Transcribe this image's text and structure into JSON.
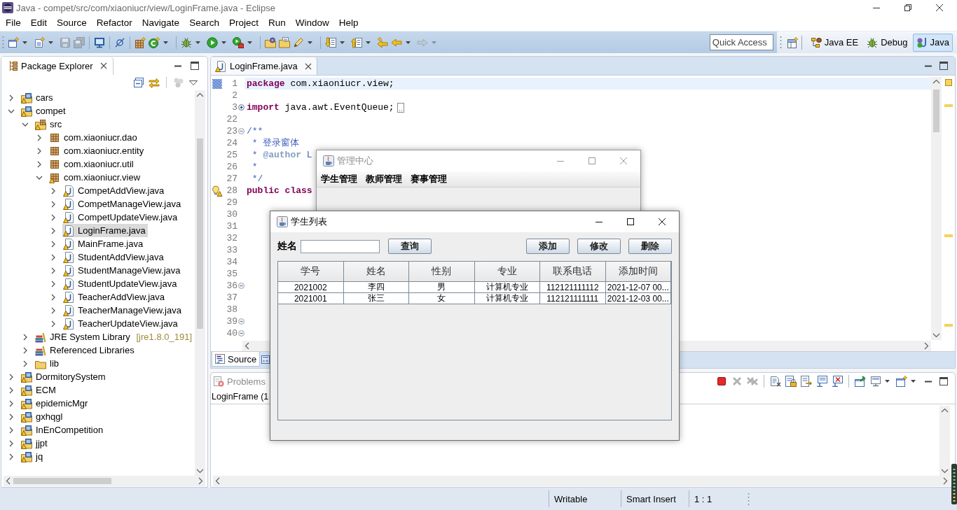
{
  "window": {
    "title": "Java - compet/src/com/xiaoniucr/view/LoginFrame.java - Eclipse"
  },
  "menu": [
    "File",
    "Edit",
    "Source",
    "Refactor",
    "Navigate",
    "Search",
    "Project",
    "Run",
    "Window",
    "Help"
  ],
  "toolbar": [
    {
      "kind": "new",
      "dropdown": true,
      "disabled": false
    },
    {
      "kind": "new-class",
      "dropdown": true,
      "disabled": false
    },
    {
      "kind": "save",
      "dropdown": false,
      "disabled": true
    },
    {
      "kind": "save-all",
      "dropdown": false,
      "disabled": true
    },
    {
      "kind": "separator"
    },
    {
      "kind": "monitor",
      "dropdown": false,
      "disabled": false
    },
    {
      "kind": "separator"
    },
    {
      "kind": "skip-breakpoints",
      "dropdown": false,
      "disabled": false
    },
    {
      "kind": "separator"
    },
    {
      "kind": "new-package",
      "dropdown": false,
      "disabled": false
    },
    {
      "kind": "refresh",
      "dropdown": true,
      "disabled": false
    },
    {
      "kind": "separator"
    },
    {
      "kind": "debug",
      "dropdown": true,
      "disabled": false
    },
    {
      "kind": "run",
      "dropdown": true,
      "disabled": false
    },
    {
      "kind": "run-external",
      "dropdown": true,
      "disabled": false
    },
    {
      "kind": "separator"
    },
    {
      "kind": "open-type",
      "dropdown": false,
      "disabled": false
    },
    {
      "kind": "open-task",
      "dropdown": false,
      "disabled": false
    },
    {
      "kind": "pen",
      "dropdown": true,
      "disabled": false
    },
    {
      "kind": "separator"
    },
    {
      "kind": "next-annotation",
      "dropdown": true,
      "disabled": false
    },
    {
      "kind": "prev-annotation",
      "dropdown": true,
      "disabled": false
    },
    {
      "kind": "last-edit",
      "dropdown": false,
      "disabled": false
    },
    {
      "kind": "back",
      "dropdown": true,
      "disabled": false
    },
    {
      "kind": "forward",
      "dropdown": true,
      "disabled": true
    }
  ],
  "quick_access": {
    "placeholder": "Quick Access"
  },
  "perspectives": [
    {
      "kind": "java-ee",
      "label": "Java EE",
      "selected": false
    },
    {
      "kind": "debug",
      "label": "Debug",
      "selected": false
    },
    {
      "kind": "java",
      "label": "Java",
      "selected": true
    }
  ],
  "package_explorer": {
    "title": "Package Explorer",
    "toolbar": [
      {
        "kind": "collapse-all",
        "dropdown": false,
        "disabled": false
      },
      {
        "kind": "link",
        "dropdown": false,
        "disabled": false
      },
      {
        "kind": "separator"
      },
      {
        "kind": "filter",
        "dropdown": false,
        "disabled": true
      },
      {
        "kind": "view-menu",
        "dropdown": false,
        "disabled": false
      }
    ],
    "tree": [
      {
        "kind": "project",
        "label": "cars",
        "warning": true,
        "expanded": false,
        "selected": false
      },
      {
        "kind": "project",
        "label": "compet",
        "warning": true,
        "expanded": true,
        "selected": false,
        "children": [
          {
            "kind": "source-folder",
            "label": "src",
            "warning": true,
            "expanded": true,
            "selected": false,
            "children": [
              {
                "kind": "package",
                "label": "com.xiaoniucr.dao",
                "warning": false,
                "expanded": false,
                "selected": false
              },
              {
                "kind": "package",
                "label": "com.xiaoniucr.entity",
                "warning": false,
                "expanded": false,
                "selected": false
              },
              {
                "kind": "package",
                "label": "com.xiaoniucr.util",
                "warning": false,
                "expanded": false,
                "selected": false
              },
              {
                "kind": "package",
                "label": "com.xiaoniucr.view",
                "warning": true,
                "expanded": true,
                "selected": false,
                "children": [
                  {
                    "kind": "java-file",
                    "label": "CompetAddView.java",
                    "warning": true,
                    "expanded": false,
                    "selected": false
                  },
                  {
                    "kind": "java-file",
                    "label": "CompetManageView.java",
                    "warning": true,
                    "expanded": false,
                    "selected": false
                  },
                  {
                    "kind": "java-file",
                    "label": "CompetUpdateView.java",
                    "warning": true,
                    "expanded": false,
                    "selected": false
                  },
                  {
                    "kind": "java-file",
                    "label": "LoginFrame.java",
                    "warning": true,
                    "expanded": false,
                    "selected": true
                  },
                  {
                    "kind": "java-file",
                    "label": "MainFrame.java",
                    "warning": true,
                    "expanded": false,
                    "selected": false
                  },
                  {
                    "kind": "java-file",
                    "label": "StudentAddView.java",
                    "warning": true,
                    "expanded": false,
                    "selected": false
                  },
                  {
                    "kind": "java-file",
                    "label": "StudentManageView.java",
                    "warning": true,
                    "expanded": false,
                    "selected": false
                  },
                  {
                    "kind": "java-file",
                    "label": "StudentUpdateView.java",
                    "warning": true,
                    "expanded": false,
                    "selected": false
                  },
                  {
                    "kind": "java-file",
                    "label": "TeacherAddView.java",
                    "warning": true,
                    "expanded": false,
                    "selected": false
                  },
                  {
                    "kind": "java-file",
                    "label": "TeacherManageView.java",
                    "warning": true,
                    "expanded": false,
                    "selected": false
                  },
                  {
                    "kind": "java-file",
                    "label": "TeacherUpdateView.java",
                    "warning": true,
                    "expanded": false,
                    "selected": false
                  }
                ]
              }
            ]
          },
          {
            "kind": "library",
            "label": "JRE System Library",
            "decoration": "[jre1.8.0_191]",
            "warning": false,
            "expanded": false,
            "selected": false
          },
          {
            "kind": "library",
            "label": "Referenced Libraries",
            "warning": false,
            "expanded": false,
            "selected": false
          },
          {
            "kind": "folder",
            "label": "lib",
            "warning": false,
            "expanded": false,
            "selected": false
          }
        ]
      },
      {
        "kind": "project",
        "label": "DormitorySystem",
        "warning": true,
        "expanded": false,
        "selected": false
      },
      {
        "kind": "project",
        "label": "ECM",
        "warning": true,
        "expanded": false,
        "selected": false
      },
      {
        "kind": "project",
        "label": "epidemicMgr",
        "warning": true,
        "expanded": false,
        "selected": false
      },
      {
        "kind": "project",
        "label": "gxhqgl",
        "warning": true,
        "expanded": false,
        "selected": false
      },
      {
        "kind": "project",
        "label": "InEnCompetition",
        "warning": true,
        "expanded": false,
        "selected": false
      },
      {
        "kind": "project",
        "label": "jjpt",
        "warning": true,
        "expanded": false,
        "selected": false
      },
      {
        "kind": "project",
        "label": "jq",
        "warning": true,
        "expanded": false,
        "selected": false
      }
    ]
  },
  "editor": {
    "tab": {
      "label": "LoginFrame.java"
    },
    "lines": [
      {
        "number": "1",
        "text": "**package** com.xiaoniucr.view;",
        "kind": "code",
        "current": true,
        "marked": true,
        "warning": false
      },
      {
        "number": "2",
        "current": false,
        "marked": false,
        "warning": false
      },
      {
        "number": "3",
        "text": "**import** java.awt.EventQueue;",
        "kind": "code",
        "current": false,
        "marked": false,
        "warning": false,
        "collapsed": true
      },
      {
        "number": "22",
        "current": false,
        "marked": false,
        "warning": false
      },
      {
        "number": "23",
        "text": "/**",
        "kind": "javadoc",
        "current": false,
        "marked": false,
        "warning": false,
        "collapsed": false
      },
      {
        "number": "24",
        "text": " * 登录窗体",
        "kind": "javadoc",
        "current": false,
        "marked": false,
        "warning": false
      },
      {
        "number": "25",
        "text": " * **@author** L",
        "kind": "javadoc",
        "current": false,
        "marked": false,
        "warning": false
      },
      {
        "number": "26",
        "text": " *",
        "kind": "javadoc",
        "current": false,
        "marked": false,
        "warning": false
      },
      {
        "number": "27",
        "text": " */",
        "kind": "javadoc",
        "current": false,
        "marked": false,
        "warning": false
      },
      {
        "number": "28",
        "text": "**public class**",
        "kind": "code",
        "current": false,
        "marked": false,
        "warning": true
      },
      {
        "number": "29",
        "current": false,
        "marked": false,
        "warning": false
      },
      {
        "number": "30",
        "current": false,
        "marked": false,
        "warning": false
      },
      {
        "number": "31",
        "current": false,
        "marked": false,
        "warning": false
      },
      {
        "number": "32",
        "current": false,
        "marked": false,
        "warning": false
      },
      {
        "number": "33",
        "current": false,
        "marked": false,
        "warning": false
      },
      {
        "number": "34",
        "current": false,
        "marked": false,
        "warning": false
      },
      {
        "number": "35",
        "current": false,
        "marked": false,
        "warning": false
      },
      {
        "number": "36",
        "current": false,
        "marked": false,
        "warning": false,
        "collapsed": false
      },
      {
        "number": "37",
        "current": false,
        "marked": false,
        "warning": false
      },
      {
        "number": "38",
        "current": false,
        "marked": false,
        "warning": false
      },
      {
        "number": "39",
        "current": false,
        "marked": false,
        "warning": false,
        "collapsed": false
      },
      {
        "number": "40",
        "current": false,
        "marked": false,
        "warning": false,
        "collapsed": false
      }
    ],
    "bottom_tabs": [
      {
        "kind": "source",
        "label": "Source",
        "selected": true
      },
      {
        "kind": "design",
        "selected": false
      }
    ]
  },
  "console": {
    "tabs": [
      {
        "label": "Problems",
        "selected": false
      }
    ],
    "description": "LoginFrame (1",
    "toolbar": [
      {
        "kind": "terminate",
        "dropdown": false,
        "disabled": false
      },
      {
        "kind": "remove",
        "dropdown": false,
        "disabled": true
      },
      {
        "kind": "remove-all",
        "dropdown": false,
        "disabled": true
      },
      {
        "kind": "separator"
      },
      {
        "kind": "clear",
        "dropdown": false,
        "disabled": false
      },
      {
        "kind": "scroll-lock",
        "dropdown": false,
        "disabled": false
      },
      {
        "kind": "word-wrap",
        "dropdown": false,
        "disabled": false
      },
      {
        "kind": "stdout",
        "dropdown": false,
        "disabled": false
      },
      {
        "kind": "stderr",
        "dropdown": false,
        "disabled": false
      },
      {
        "kind": "separator"
      },
      {
        "kind": "pin",
        "dropdown": false,
        "disabled": false
      },
      {
        "kind": "display-console",
        "dropdown": true,
        "disabled": false
      },
      {
        "kind": "new-console",
        "dropdown": true,
        "disabled": false
      }
    ]
  },
  "status_bar": [
    "Writable",
    "Smart Insert",
    "1 : 1"
  ],
  "manage_window": {
    "title": "管理中心",
    "active": false,
    "menu": [
      "学生管理",
      "教师管理",
      "赛事管理"
    ]
  },
  "student_window": {
    "title": "学生列表",
    "active": true,
    "search": {
      "label": "姓名",
      "button": "查询"
    },
    "actions": [
      "添加",
      "修改",
      "删除"
    ],
    "table": {
      "columns": [
        "学号",
        "姓名",
        "性别",
        "专业",
        "联系电话",
        "添加时间"
      ],
      "rows": [
        [
          "2021002",
          "李四",
          "男",
          "计算机专业",
          "112121111112",
          "2021-12-07 00..."
        ],
        [
          "2021001",
          "张三",
          "女",
          "计算机专业",
          "112121111111",
          "2021-12-03 00..."
        ]
      ]
    }
  }
}
